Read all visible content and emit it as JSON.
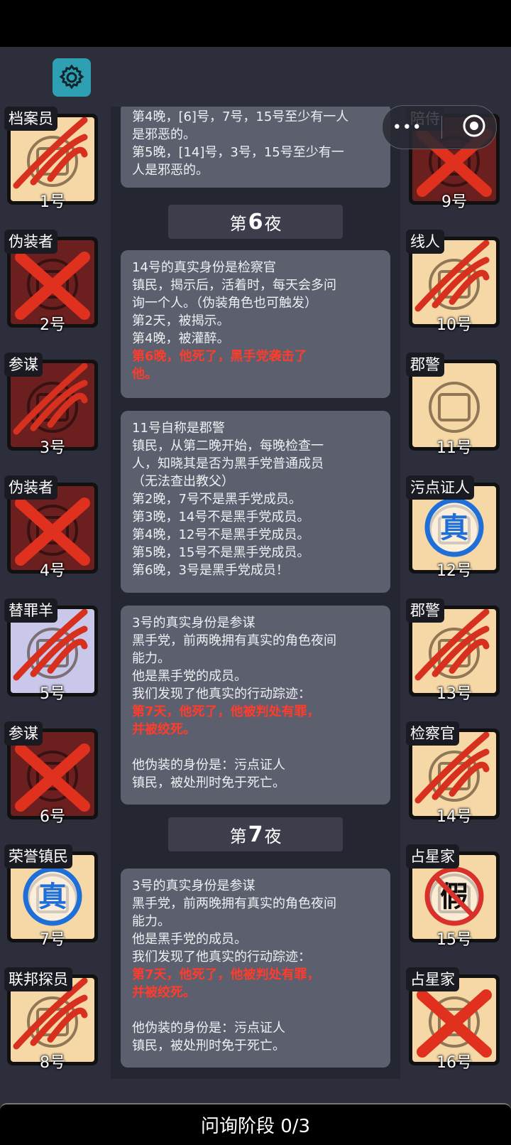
{
  "status_bar": {},
  "capsule": {
    "more": "•••",
    "close": "target"
  },
  "nights": [
    {
      "prefix": "第",
      "num": "6",
      "suffix": "夜"
    },
    {
      "prefix": "第",
      "num": "7",
      "suffix": "夜"
    }
  ],
  "cards": [
    {
      "lines": [
        "第4晚，[6]号，7号，15号至少有一人",
        "是邪恶的。",
        "第5晚，[14]号，3号，15号至少有一",
        "人是邪恶的。"
      ],
      "red": []
    },
    {
      "lines": [
        "14号的真实身份是检察官",
        "镇民，揭示后，活着时，每天会多问",
        "询一个人。（伪装角色也可触发）",
        "第2天，被揭示。",
        "第4晚，被灌醉。"
      ],
      "red": [
        "第6晚，他死了，黑手党袭击了",
        "他。"
      ]
    },
    {
      "lines": [
        "11号自称是郡警",
        "镇民，从第二晚开始，每晚检查一",
        "人，知晓其是否为黑手党普通成员",
        "（无法查出教父）",
        "第2晚，7号不是黑手党成员。",
        "第3晚，14号不是黑手党成员。",
        "第4晚，12号不是黑手党成员。",
        "第5晚，15号不是黑手党成员。",
        "第6晚，3号是黑手党成员！"
      ],
      "red": []
    },
    {
      "lines": [
        "3号的真实身份是参谋",
        "黑手党，前两晚拥有真实的角色夜间",
        "能力。",
        "他是黑手党的成员。",
        "我们发现了他真实的行动踪迹："
      ],
      "red": [
        "第7天，他死了，他被判处有罪，",
        "并被绞死。"
      ],
      "after": [
        "",
        "他伪装的身份是：污点证人",
        "镇民，被处刑时免于死亡。"
      ]
    },
    {
      "lines": [
        "3号的真实身份是参谋",
        "黑手党，前两晚拥有真实的角色夜间",
        "能力。",
        "他是黑手党的成员。",
        "我们发现了他真实的行动踪迹："
      ],
      "red": [
        "第7天，他死了，他被判处有罪，",
        "并被绞死。"
      ],
      "after": [
        "",
        "他伪装的身份是：污点证人",
        "镇民，被处刑时免于死亡。"
      ]
    }
  ],
  "players_left": [
    {
      "role": "档案员",
      "num": "1号",
      "state": "claw",
      "bg": "#f6d8a6",
      "icon": "archivist-icon"
    },
    {
      "role": "伪装者",
      "num": "2号",
      "state": "cross",
      "bg": "#6b1f1f",
      "icon": "mask-icon"
    },
    {
      "role": "参谋",
      "num": "3号",
      "state": "claw",
      "bg": "#6b1f1f",
      "icon": "strategist-icon"
    },
    {
      "role": "伪装者",
      "num": "4号",
      "state": "cross",
      "bg": "#6b1f1f",
      "icon": "mask-icon"
    },
    {
      "role": "替罪羊",
      "num": "5号",
      "state": "claw",
      "bg": "#c9c8ea",
      "icon": "goat-icon"
    },
    {
      "role": "参谋",
      "num": "6号",
      "state": "cross",
      "bg": "#6b1f1f",
      "icon": "strategist-icon"
    },
    {
      "role": "荣誉镇民",
      "num": "7号",
      "state": "true",
      "bg": "#f6d8a6",
      "icon": "true-stamp-icon"
    },
    {
      "role": "联邦探员",
      "num": "8号",
      "state": "claw",
      "bg": "#f6d8a6",
      "icon": "agent-icon"
    }
  ],
  "players_right": [
    {
      "role": "陪侍",
      "num": "9号",
      "state": "cross",
      "bg": "#6b1f1f",
      "icon": "escort-icon"
    },
    {
      "role": "线人",
      "num": "10号",
      "state": "claw",
      "bg": "#f6d8a6",
      "icon": "envelope-icon"
    },
    {
      "role": "郡警",
      "num": "11号",
      "state": "alive",
      "bg": "#f6d8a6",
      "icon": "sheriff-badge-icon"
    },
    {
      "role": "污点证人",
      "num": "12号",
      "state": "true",
      "bg": "#f6d8a6",
      "icon": "true-stamp-icon"
    },
    {
      "role": "郡警",
      "num": "13号",
      "state": "claw",
      "bg": "#f6d8a6",
      "icon": "sheriff-badge-icon"
    },
    {
      "role": "检察官",
      "num": "14号",
      "state": "claw",
      "bg": "#f6d8a6",
      "icon": "prosecutor-icon"
    },
    {
      "role": "占星家",
      "num": "15号",
      "state": "fake",
      "bg": "#f6d8a6",
      "icon": "fake-stamp-icon"
    },
    {
      "role": "占星家",
      "num": "16号",
      "state": "cross",
      "bg": "#f6d8a6",
      "icon": "astrologer-icon"
    }
  ],
  "bottom": {
    "label": "问询阶段 0/3"
  },
  "stamps": {
    "true": "真",
    "fake": "假"
  },
  "colors": {
    "accent": "#2fa0b4",
    "red": "#ff3c2c",
    "card": "#5c5f6d"
  }
}
